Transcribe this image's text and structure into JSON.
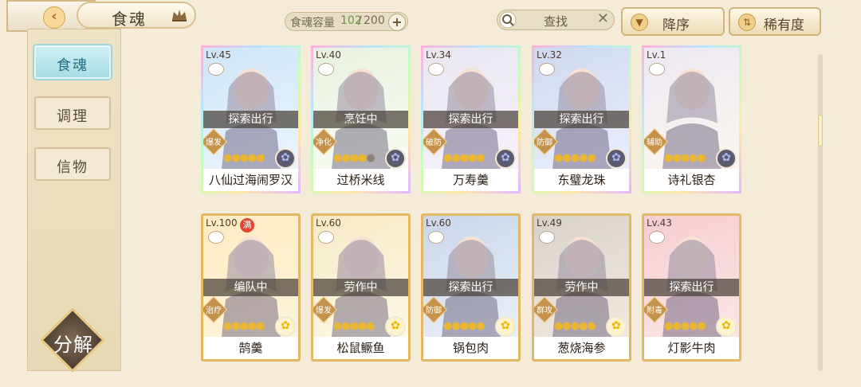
{
  "header": {
    "title": "食魂",
    "capacity_label": "食魂容量",
    "capacity_current": "102",
    "capacity_sep": "/",
    "capacity_max": "200",
    "capacity_add": "+",
    "search_label": "查找",
    "search_clear": "✕",
    "sort_order": "降序",
    "sort_key": "稀有度",
    "accent": "#d1b477"
  },
  "sidebar": {
    "items": [
      {
        "label": "食魂",
        "active": true
      },
      {
        "label": "调理",
        "active": false
      },
      {
        "label": "信物",
        "active": false
      }
    ],
    "decompose_label": "分解"
  },
  "cards": [
    {
      "level": "Lv.45",
      "status": "探索出行",
      "role": "爆发",
      "stars": 5,
      "name": "八仙过海闹罗汉",
      "frame": "rainbow",
      "flower": "blue",
      "max_badge": ""
    },
    {
      "level": "Lv.40",
      "status": "烹饪中",
      "role": "净化",
      "stars": 4,
      "name": "过桥米线",
      "frame": "rainbow",
      "flower": "blue",
      "max_badge": ""
    },
    {
      "level": "Lv.34",
      "status": "探索出行",
      "role": "破防",
      "stars": 5,
      "name": "万寿羹",
      "frame": "rainbow",
      "flower": "blue",
      "max_badge": ""
    },
    {
      "level": "Lv.32",
      "status": "探索出行",
      "role": "防御",
      "stars": 5,
      "name": "东璧龙珠",
      "frame": "rainbow",
      "flower": "blue",
      "max_badge": ""
    },
    {
      "level": "Lv.1",
      "status": "",
      "role": "辅助",
      "stars": 5,
      "name": "诗礼银杏",
      "frame": "rainbow",
      "flower": "blue",
      "max_badge": ""
    },
    {
      "level": "Lv.100",
      "status": "编队中",
      "role": "治疗",
      "stars": 5,
      "name": "鹄羹",
      "frame": "gold",
      "flower": "gold",
      "max_badge": "满"
    },
    {
      "level": "Lv.60",
      "status": "劳作中",
      "role": "爆发",
      "stars": 5,
      "name": "松鼠鳜鱼",
      "frame": "gold",
      "flower": "gold",
      "max_badge": ""
    },
    {
      "level": "Lv.60",
      "status": "探索出行",
      "role": "防御",
      "stars": 5,
      "name": "锅包肉",
      "frame": "gold",
      "flower": "gold",
      "max_badge": ""
    },
    {
      "level": "Lv.49",
      "status": "劳作中",
      "role": "群攻",
      "stars": 5,
      "name": "葱烧海参",
      "frame": "gold",
      "flower": "gold",
      "max_badge": ""
    },
    {
      "level": "Lv.43",
      "status": "探索出行",
      "role": "附毒",
      "stars": 5,
      "name": "灯影牛肉",
      "frame": "gold",
      "flower": "gold",
      "max_badge": ""
    }
  ]
}
